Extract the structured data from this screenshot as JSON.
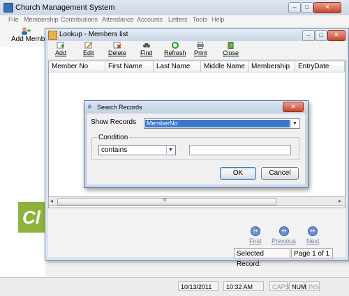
{
  "main": {
    "title": "Church Management System",
    "window_buttons": {
      "minimize": "–",
      "maximize": "□",
      "close": "✕"
    },
    "menu": [
      "File",
      "Membership",
      "Contributions",
      "Attendance",
      "Accounts",
      "Letters",
      "Tools",
      "Help"
    ],
    "toolbar": {
      "add_member": "Add Member"
    },
    "logo_text": "Cl"
  },
  "lookup": {
    "title": "Lookup - Members list",
    "window_buttons": {
      "minimize": "–",
      "maximize": "□",
      "close": "✕"
    },
    "toolbar": {
      "add": "Add",
      "edit": "Edit",
      "delete": "Delete",
      "find": "Find",
      "refresh": "Refresh",
      "print": "Print",
      "close": "Close"
    },
    "columns": [
      "Member No",
      "First Name",
      "Last Name",
      "Middle Name",
      "Membership",
      "EntryDate"
    ],
    "scroll_grip": "III",
    "nav": {
      "first": "First",
      "previous": "Previous",
      "next": "Next"
    },
    "selected_record_label": "Selected Record:",
    "page_info": "Page 1 of 1"
  },
  "search": {
    "title": "Search Records",
    "close": "✕",
    "show_records_label": "Show Records",
    "show_records_value": "MemberNo",
    "condition_label": "Condition",
    "condition_value": "contains",
    "condition_text": "",
    "ok": "OK",
    "cancel": "Cancel"
  },
  "status": {
    "date": "10/13/2011",
    "time": "10:32 AM",
    "caps": "CAPS",
    "num": "NUM",
    "ins": "INS"
  }
}
